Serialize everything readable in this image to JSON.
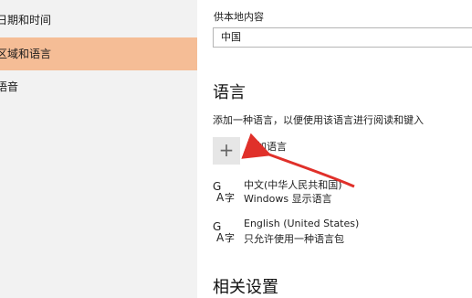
{
  "sidebar": {
    "items": [
      {
        "label": "日期和时间",
        "active": false
      },
      {
        "label": "区域和语言",
        "active": true
      },
      {
        "label": "语音",
        "active": false
      }
    ]
  },
  "region": {
    "label": "供本地内容",
    "selected": "中国"
  },
  "language": {
    "title": "语言",
    "description": "添加一种语言，以便使用该语言进行阅读和键入",
    "add_label": "添加语言",
    "items": [
      {
        "name": "中文(中华人民共和国)",
        "sub": "Windows 显示语言",
        "icon": "language-icon"
      },
      {
        "name": "English (United States)",
        "sub": "只允许使用一种语言包",
        "icon": "language-icon"
      }
    ]
  },
  "related": {
    "title": "相关设置"
  },
  "colors": {
    "active_item": "#f5bd96",
    "annotation_arrow": "#e0302a"
  }
}
